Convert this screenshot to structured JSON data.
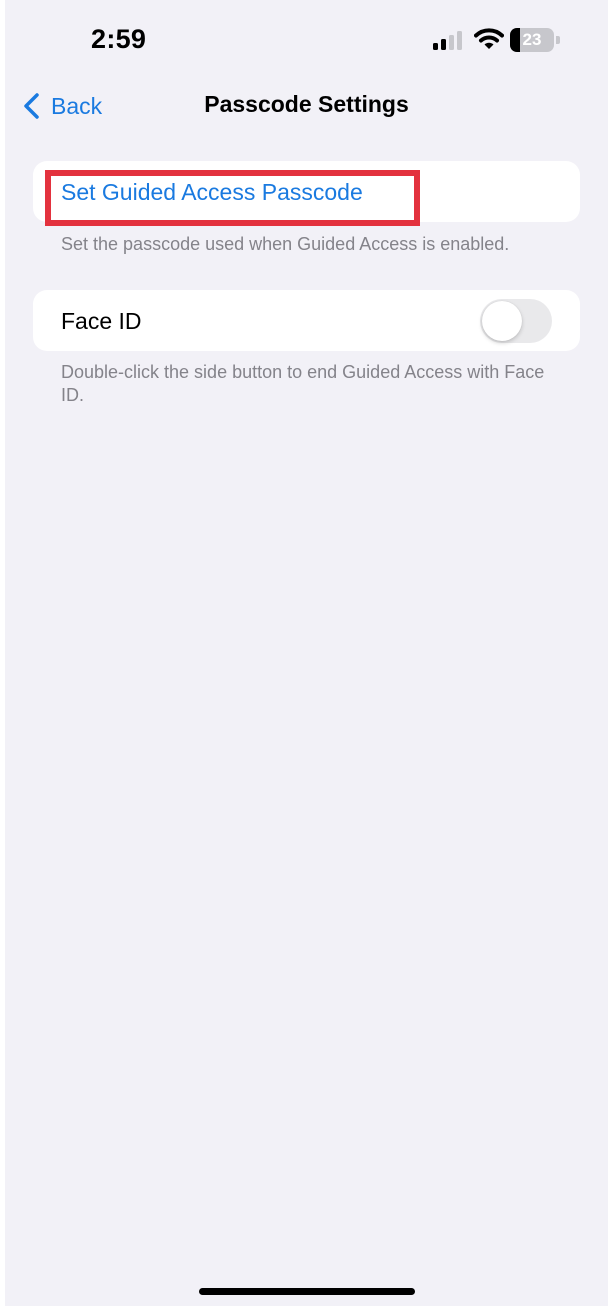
{
  "status_bar": {
    "time": "2:59",
    "battery_level": "23",
    "battery_percent": 23,
    "icons": [
      "signal-icon",
      "wifi-icon",
      "battery-icon"
    ]
  },
  "nav": {
    "back_label": "Back",
    "title": "Passcode Settings"
  },
  "passcode_group": {
    "set_passcode_label": "Set Guided Access Passcode",
    "footer": "Set the passcode used when Guided Access is enabled."
  },
  "face_id_group": {
    "label": "Face ID",
    "toggle_on": false,
    "footer": "Double-click the side button to end Guided Access with Face ID."
  },
  "colors": {
    "accent": "#1a7ae0",
    "highlight": "#e3323e",
    "background": "#f2f1f7",
    "toggle_off": "#e9e9eb"
  }
}
